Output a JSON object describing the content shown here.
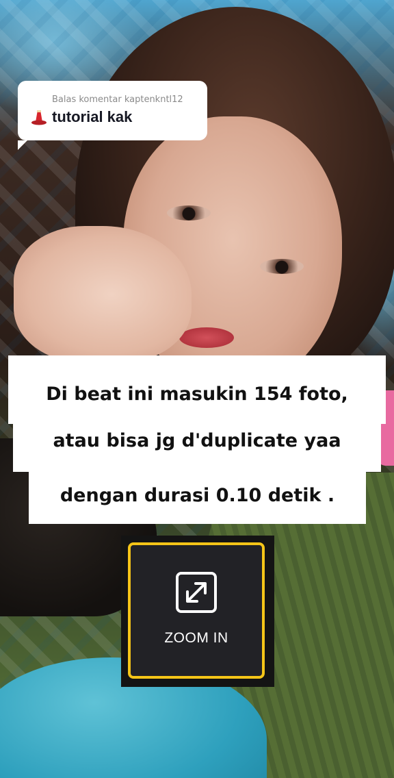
{
  "reply": {
    "meta": "Balas komentar kaptenkntl12",
    "text": "tutorial kak",
    "avatar_icon": "red-hat-avatar-icon"
  },
  "caption": {
    "lines": [
      "Di beat ini masukin 154 foto,",
      "atau bisa jg d'duplicate yaa",
      "dengan durasi 0.10 detik ."
    ]
  },
  "zoom_button": {
    "label": "ZOOM IN",
    "icon": "expand-arrows-icon",
    "highlight_color": "#f5c518"
  },
  "colors": {
    "bubble_bg": "#ffffff",
    "caption_bg": "#ffffff",
    "tile_bg": "#222226"
  }
}
